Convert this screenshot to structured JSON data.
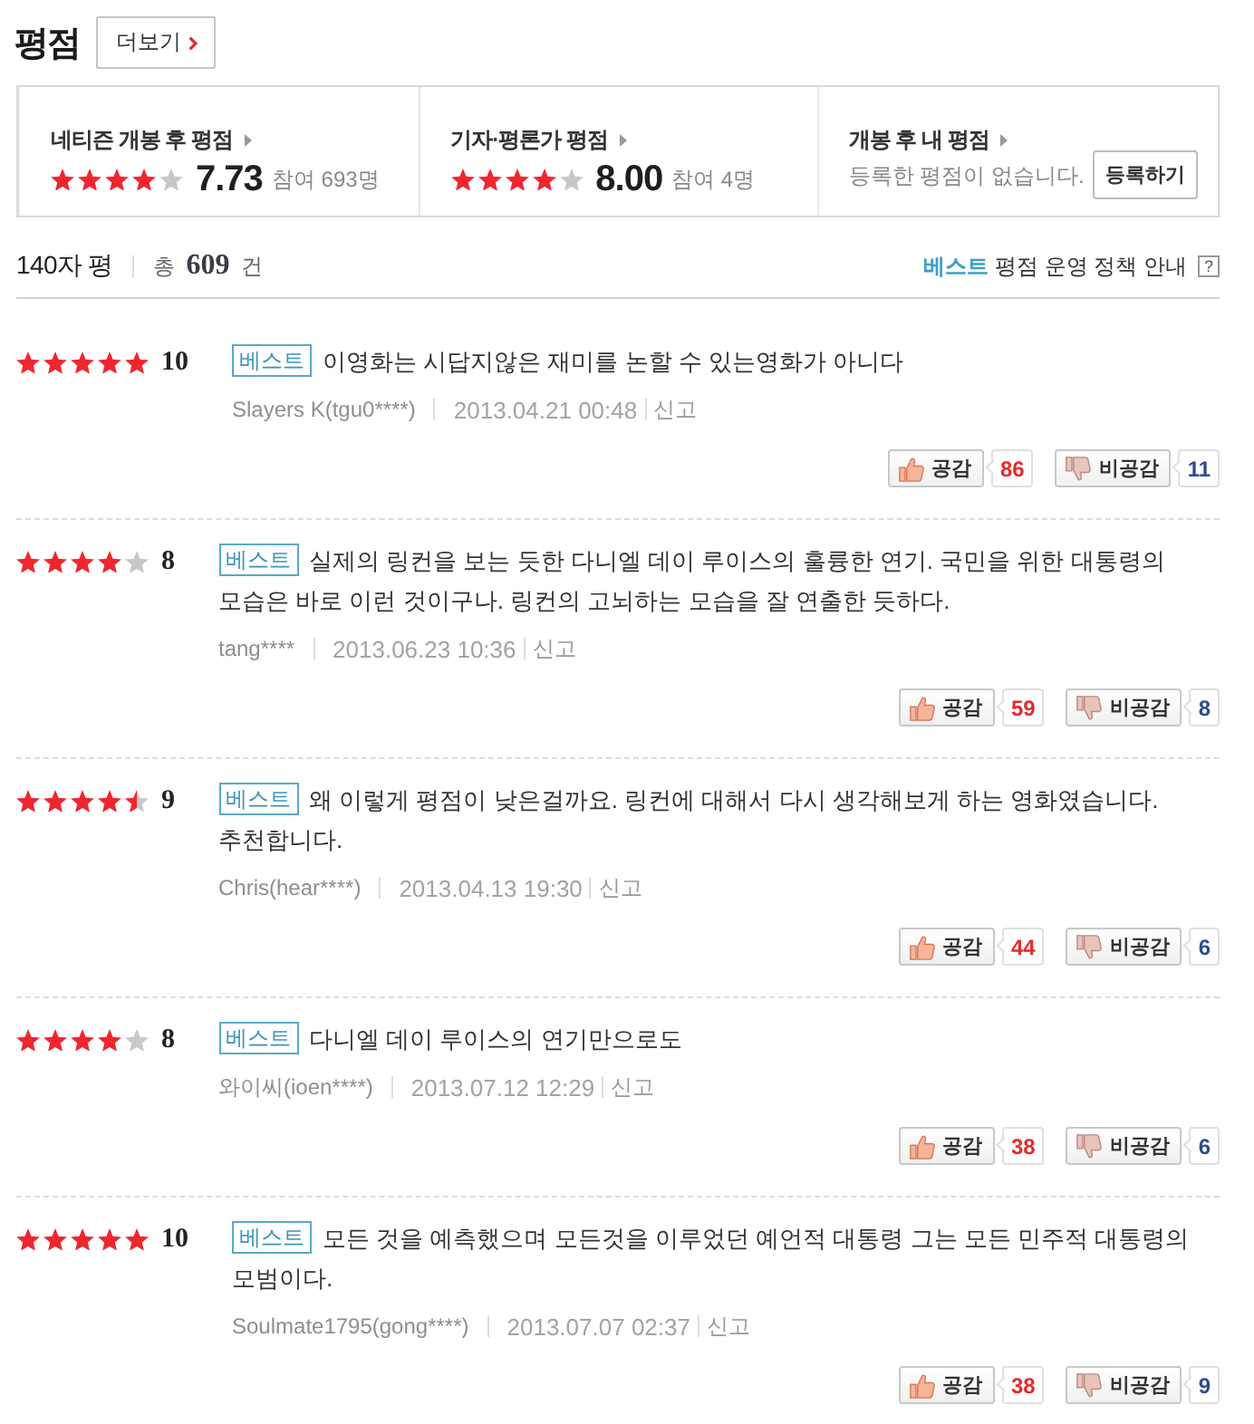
{
  "header": {
    "title": "평점",
    "more_button": "더보기"
  },
  "summary": [
    {
      "kind": "score",
      "label": "네티즌 개봉 후 평점",
      "stars": 4,
      "score": "7.73",
      "participants": "참여 693명"
    },
    {
      "kind": "score",
      "label": "기자·평론가 평점",
      "stars": 4,
      "score": "8.00",
      "participants": "참여 4명"
    },
    {
      "kind": "mine",
      "label": "개봉 후 내 평점",
      "message": "등록한 평점이 없습니다.",
      "button": "등록하기"
    }
  ],
  "list_header": {
    "title": "140자 평",
    "total": "총 **609** 건",
    "policy_link": "**베스트** 평점 운영 정책 안내",
    "help": "?"
  },
  "reviews": [
    {
      "stars": 5,
      "score": "10",
      "badge": "베스트",
      "text": "이영화는 시답지않은 재미를 논할 수 있는영화가 아니다",
      "author": "Slayers K(tgu0****)",
      "date": "2013.04.21 00:48",
      "report": "신고",
      "like_label": "공감",
      "likes": "86",
      "dislike_label": "비공감",
      "dislikes": "11"
    },
    {
      "stars": 4,
      "score": "8",
      "badge": "베스트",
      "text": "실제의 링컨을 보는 듯한 다니엘 데이 루이스의 훌륭한 연기. 국민을 위한 대통령의 모습은 바로 이런 것이구나. 링컨의 고뇌하는 모습을 잘 연출한 듯하다.",
      "author": "tang****",
      "date": "2013.06.23 10:36",
      "report": "신고",
      "like_label": "공감",
      "likes": "59",
      "dislike_label": "비공감",
      "dislikes": "8"
    },
    {
      "stars": 4.5,
      "score": "9",
      "badge": "베스트",
      "text": "왜 이렇게 평점이 낮은걸까요. 링컨에 대해서 다시 생각해보게 하는 영화였습니다. 추천합니다.",
      "author": "Chris(hear****)",
      "date": "2013.04.13 19:30",
      "report": "신고",
      "like_label": "공감",
      "likes": "44",
      "dislike_label": "비공감",
      "dislikes": "6"
    },
    {
      "stars": 4,
      "score": "8",
      "badge": "베스트",
      "text": "다니엘 데이 루이스의 연기만으로도",
      "author": "와이씨(ioen****)",
      "date": "2013.07.12 12:29",
      "report": "신고",
      "like_label": "공감",
      "likes": "38",
      "dislike_label": "비공감",
      "dislikes": "6"
    },
    {
      "stars": 5,
      "score": "10",
      "badge": "베스트",
      "text": "모든 것을 예측했으며 모든것을 이루었던 예언적 대통령 그는 모든 민주적 대통령의 모범이다.",
      "author": "Soulmate1795(gong****)",
      "date": "2013.07.07 02:37",
      "report": "신고",
      "like_label": "공감",
      "likes": "38",
      "dislike_label": "비공감",
      "dislikes": "9"
    }
  ]
}
